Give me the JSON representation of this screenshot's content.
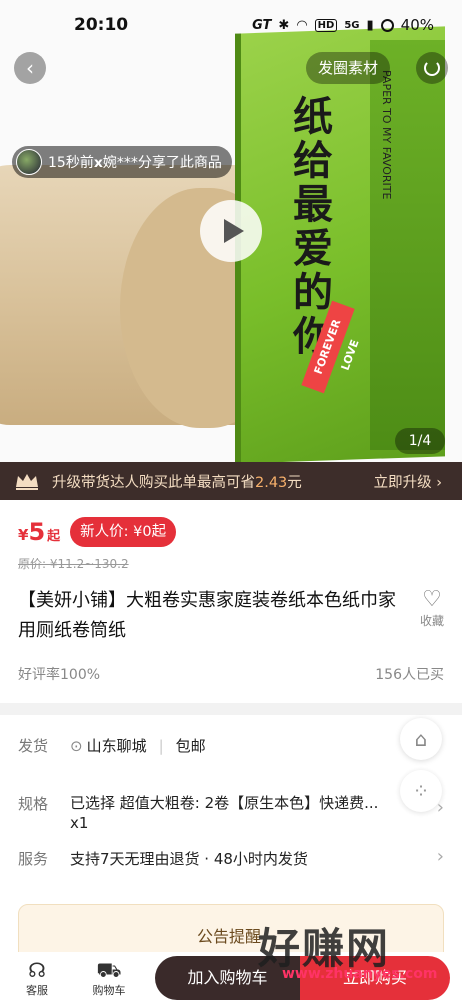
{
  "status_bar": {
    "time": "20:10",
    "network": "GT",
    "hd": "HD",
    "signal": "5G",
    "battery": "40%"
  },
  "hero": {
    "material_label": "发圈素材",
    "share_notice": "15秒前𝘅婉***分享了此商品",
    "pager": "1/4",
    "pack_title": "纸给最爱的你",
    "pack_brand": "PAPER TO MY FAVORITE",
    "pack_stamp": "FOREVER LOVE"
  },
  "upgrade": {
    "text_prefix": "升级带货达人购买此单最高可省",
    "amount": "2.43",
    "text_suffix": "元",
    "action": "立即升级"
  },
  "price": {
    "currency": "¥",
    "value": "5",
    "suffix": "起",
    "newbie_label": "新人价: ¥0起",
    "original": "原价: ¥11.2~130.2"
  },
  "product": {
    "title": "【美妍小铺】大粗卷实惠家庭装卷纸本色纸巾家用厕纸卷筒纸",
    "fav_label": "收藏",
    "rating": "好评率100%",
    "sold": "156人已买"
  },
  "details": {
    "ship_label": "发货",
    "ship_from": "山东聊城",
    "ship_free": "包邮",
    "spec_label": "规格",
    "spec_value": "已选择  超值大粗卷: 2卷【原生本色】快递费...",
    "spec_count": "x1",
    "service_label": "服务",
    "service_value": "支持7天无理由退货 · 48小时内发货"
  },
  "notice": {
    "title": "公告提醒"
  },
  "bottom": {
    "service_tab": "客服",
    "cart_tab": "购物车",
    "add_cart": "加入购物车",
    "buy_now": "立即购买"
  },
  "watermark": {
    "text": "好赚网",
    "url": "www.zhuanyes.com"
  },
  "colors": {
    "accent": "#e5303a",
    "upgrade_bg": "#3d2d2a",
    "upgrade_amount": "#f7b06b"
  }
}
